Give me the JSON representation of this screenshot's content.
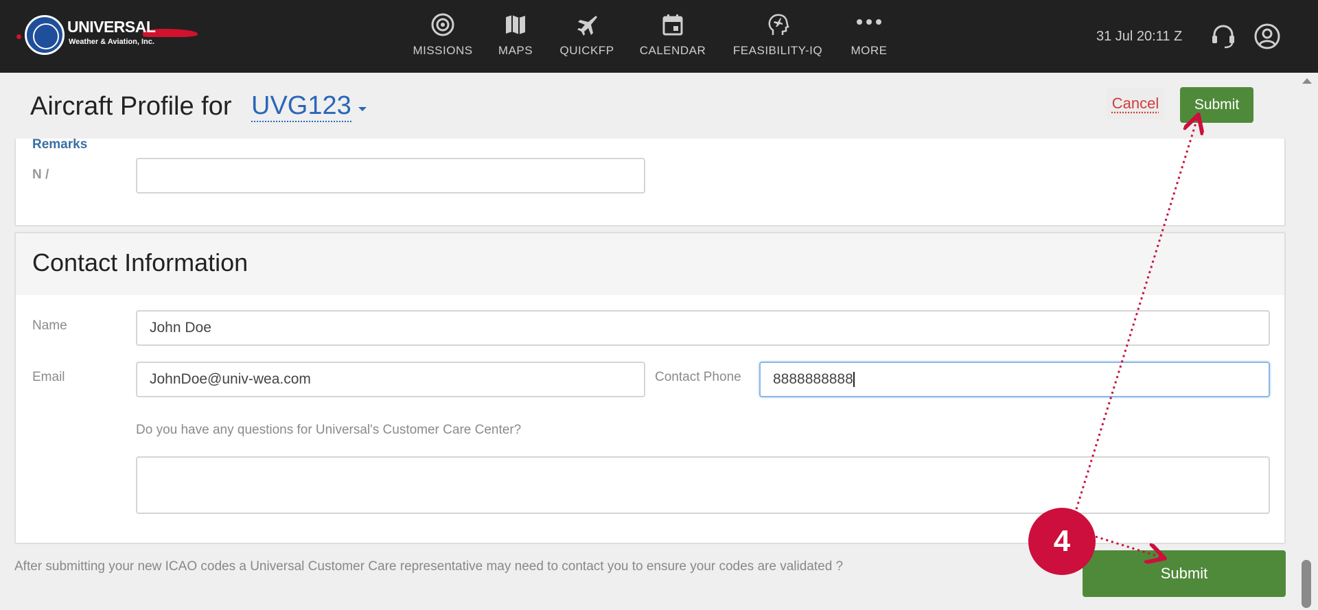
{
  "header": {
    "logo": {
      "name": "UNIVERSAL",
      "subtitle": "Weather & Aviation, Inc."
    },
    "nav": [
      {
        "label": "MISSIONS",
        "icon": "target-icon"
      },
      {
        "label": "MAPS",
        "icon": "map-icon"
      },
      {
        "label": "QUICKFP",
        "icon": "airplane-icon"
      },
      {
        "label": "CALENDAR",
        "icon": "calendar-icon"
      },
      {
        "label": "FEASIBILITY-IQ",
        "icon": "head-plane-icon"
      },
      {
        "label": "MORE",
        "icon": "more-dots-icon"
      }
    ],
    "clock": "31 Jul 20:11 Z",
    "support_icon": "headset-icon",
    "account_icon": "user-circle-icon"
  },
  "profile_header": {
    "title_prefix": "Aircraft Profile for",
    "tail_number": "UVG123",
    "cancel_label": "Cancel",
    "submit_label": "Submit"
  },
  "remarks": {
    "title": "Remarks",
    "row_label": "N /",
    "value": ""
  },
  "contact": {
    "title": "Contact Information",
    "name_label": "Name",
    "name_value": "John Doe",
    "email_label": "Email",
    "email_value": "JohnDoe@univ-wea.com",
    "phone_label": "Contact Phone",
    "phone_value": "8888888888",
    "question_label": "Do you have any questions for Universal's Customer Care Center?",
    "question_value": ""
  },
  "footer": {
    "note": "After submitting your new ICAO codes a Universal Customer Care representative may need to contact you to ensure your codes are validated ?",
    "submit_label": "Submit"
  },
  "annotation": {
    "step_number": "4",
    "arrow_color": "#cc0f3d"
  },
  "colors": {
    "topbar": "#212121",
    "submit_green": "#4f8a3a",
    "link_blue": "#2a66b8",
    "cancel_red": "#d23b3b"
  }
}
